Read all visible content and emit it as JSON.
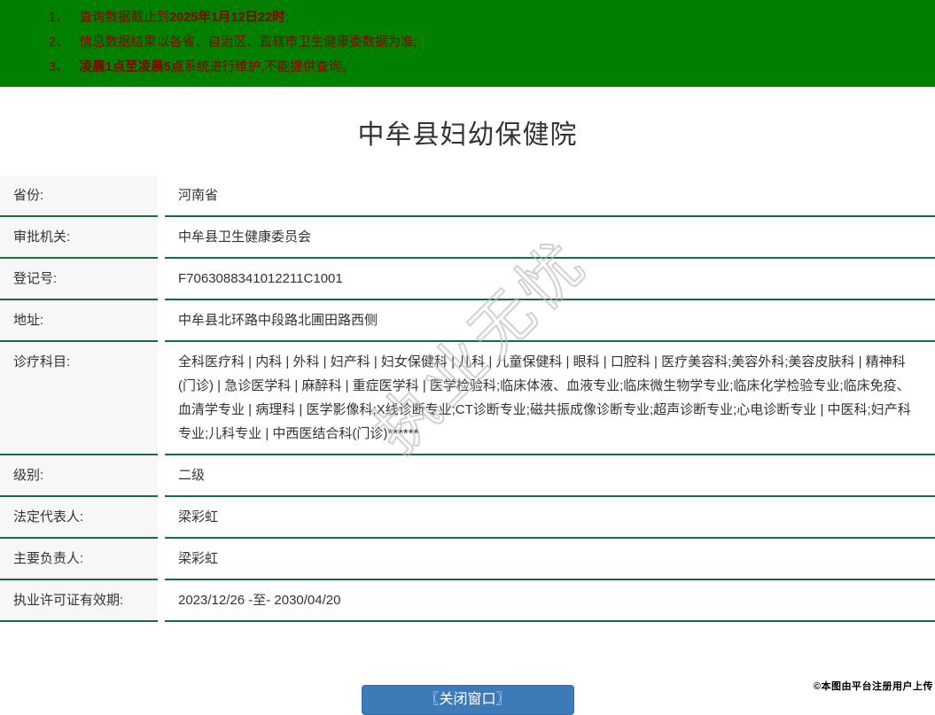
{
  "notice": {
    "bg_color": "#008000",
    "text_color": "#8b0000",
    "items": [
      {
        "num": "1、",
        "pre": "查询数据截止到",
        "bold": "2025年1月12日22时",
        "post": ";"
      },
      {
        "num": "2、",
        "pre": "信息数据结果以各省、自治区、直辖市卫生健康委数据为准;",
        "bold": "",
        "post": ""
      },
      {
        "num": "3、",
        "pre": "",
        "bold": "凌晨1点至凌晨5点",
        "post": "系统进行维护,不能提供查询。"
      }
    ]
  },
  "title": "中牟县妇幼保健院",
  "table": {
    "label_bg": "#f7f7f7",
    "border_color": "#1a6b3c",
    "rows": [
      {
        "label": "省份:",
        "value": "河南省"
      },
      {
        "label": "审批机关:",
        "value": "中牟县卫生健康委员会"
      },
      {
        "label": "登记号:",
        "value": "F7063088341012211C1001"
      },
      {
        "label": "地址:",
        "value": "中牟县北环路中段路北圃田路西侧"
      },
      {
        "label": "诊疗科目:",
        "value": "全科医疗科 | 内科 | 外科 | 妇产科 | 妇女保健科 | 儿科 | 儿童保健科 | 眼科 | 口腔科 | 医疗美容科;美容外科;美容皮肤科 | 精神科(门诊) | 急诊医学科 | 麻醉科 | 重症医学科 | 医学检验科;临床体液、血液专业;临床微生物学专业;临床化学检验专业;临床免疫、血清学专业 | 病理科 | 医学影像科;X线诊断专业;CT诊断专业;磁共振成像诊断专业;超声诊断专业;心电诊断专业 | 中医科;妇产科专业;儿科专业 | 中西医结合科(门诊)******"
      },
      {
        "label": "级别:",
        "value": "二级"
      },
      {
        "label": "法定代表人:",
        "value": "梁彩虹"
      },
      {
        "label": "主要负责人:",
        "value": "梁彩虹"
      },
      {
        "label": "执业许可证有效期:",
        "value": "2023/12/26 -至- 2030/04/20"
      }
    ]
  },
  "button": {
    "label": "〖关闭窗口〗",
    "bg_color": "#3d7ab8"
  },
  "watermark_text": "执业无忧",
  "copyright": "©本图由平台注册用户上传"
}
